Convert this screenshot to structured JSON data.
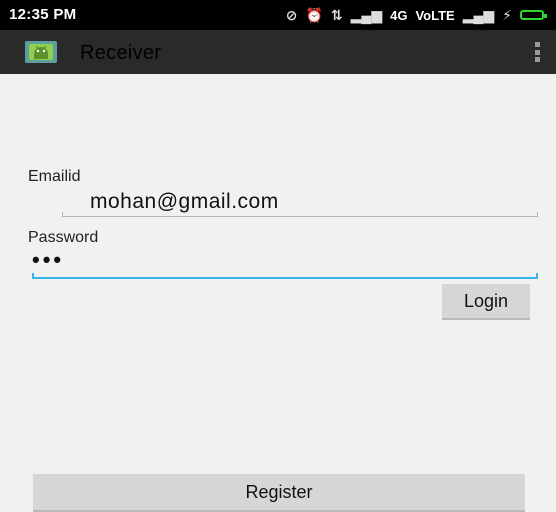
{
  "status_bar": {
    "time": "12:35 PM",
    "network_1": "4G",
    "network_2": "VoLTE",
    "battery_color": "#2ed82e"
  },
  "action_bar": {
    "title": "Receiver",
    "icon": "android-app-icon",
    "menu_icon": "overflow-menu-icon",
    "background": "#2a2a2a"
  },
  "form": {
    "email_label": "Emailid",
    "email_value": "mohan@gmail.com",
    "password_label": "Password",
    "password_value": "•••",
    "accent_color": "#34b5e5"
  },
  "buttons": {
    "login_label": "Login",
    "register_label": "Register"
  }
}
